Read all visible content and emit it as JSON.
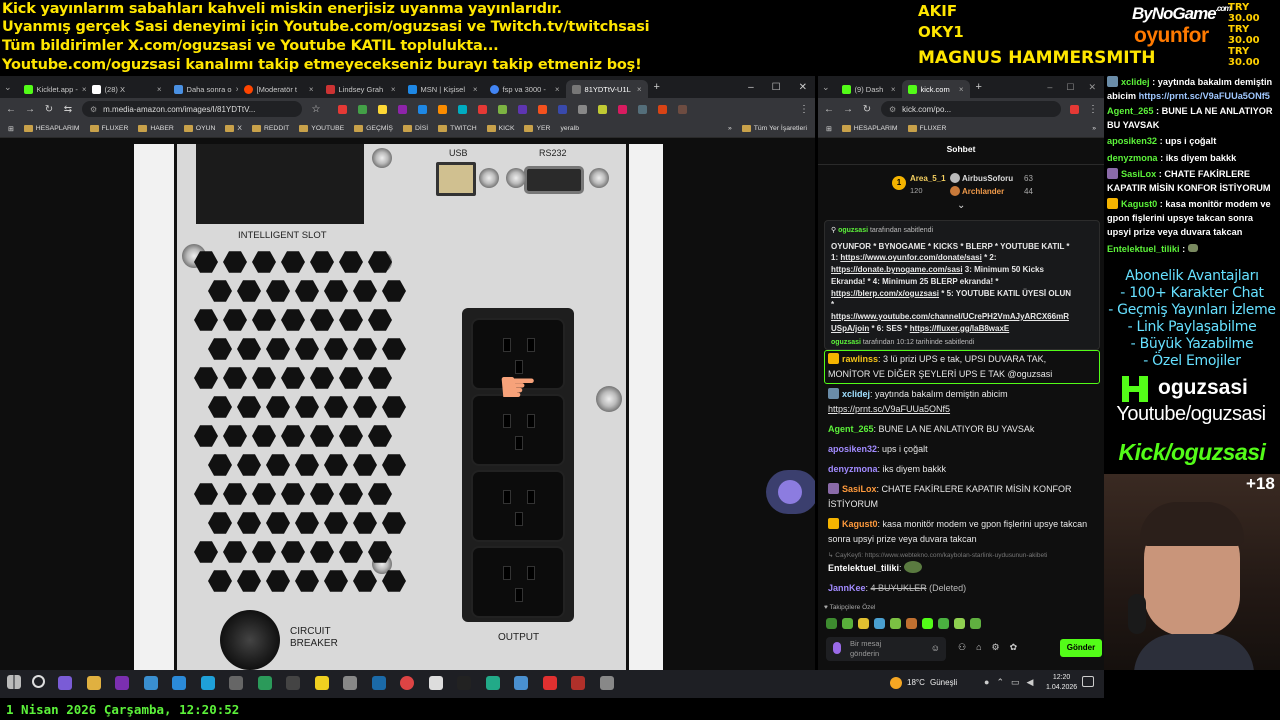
{
  "ticker": {
    "line1": "Kick yayınlarım sabahları kahveli miskin enerjisiz uyanma yayınlarıdır.",
    "line2": "Uyanmış gerçek Sasi deneyimi için Youtube.com/oguzsasi ve Twitch.tv/twitchsasi",
    "line3": "Tüm bildirimler X.com/oguzsasi ve Youtube KATIL toplulukta...",
    "line4": "Youtube.com/oguzsasi kanalımı takip etmeyecekseniz burayı takip etmeniz boş!"
  },
  "supporters": [
    "AKIF",
    "OKY1",
    "MAGNUS HAMMERSMITH"
  ],
  "brand": {
    "bynogame": "ByNoGame",
    "bynogame_sup": ".com",
    "oyunfor": "oyunfor"
  },
  "donations": [
    "TRY 30.00",
    "TRY 30.00",
    "TRY 30.00"
  ],
  "browser_left": {
    "tabs": [
      "Kicklet.app -",
      "(28) X",
      "Daha sonra o",
      "[Moderatör t",
      "Lindsey Grah",
      "MSN | Kişisel",
      "fsp va 3000 -",
      "81YDTtV-U1L"
    ],
    "url": "m.media-amazon.com/images/I/81YDTtV...",
    "bookmarks": [
      "HESAPLARIM",
      "FLUXER",
      "HABER",
      "OYUN",
      "X",
      "REDDIT",
      "YOUTUBE",
      "GEÇMİŞ",
      "DİSİ",
      "TWITCH",
      "KICK",
      "YER",
      "yeralb"
    ],
    "all_bookmarks": "Tüm Yer İşaretleri"
  },
  "ups": {
    "usb": "USB",
    "rs232": "RS232",
    "intelligent_slot": "INTELLIGENT SLOT",
    "circuit_breaker_1": "CIRCUIT",
    "circuit_breaker_2": "BREAKER",
    "output": "OUTPUT"
  },
  "browser_right": {
    "tabs": [
      "(9) Dash",
      "kick.com"
    ],
    "url": "kick.com/po...",
    "bookmarks": [
      "HESAPLARIM",
      "FLUXER"
    ],
    "chat_title": "Sohbet",
    "leaderboard": [
      {
        "rank": "1",
        "name": "Area_5_1",
        "value": "120"
      },
      {
        "name": "AirbusSoforu",
        "value": "63"
      },
      {
        "name": "Archlander",
        "value": "44"
      }
    ],
    "pinned": {
      "by": "oguzsasi",
      "by_suffix": "tarafından sabitlendi",
      "l1": "OYUNFOR * BYNOGAME * KICKS * BLERP * YOUTUBE KATIL *",
      "l2a": "1: ",
      "l2link": "https://www.oyunfor.com/donate/sasi",
      "l2b": " * 2:",
      "l3link": "https://donate.bynogame.com/sasi",
      "l3b": " 3: Minimum 50 Kicks",
      "l4": "Ekranda! * 4: Minimum 25 BLERP ekranda! *",
      "l5link": "https://blerp.com/x/oguzsasi",
      "l5b": " * 5: YOUTUBE KATIL ÜYESİ OLUN",
      "l6": "*",
      "l7link": "https://www.youtube.com/channel/UCrePH2VmAJyARCX66mR",
      "l8link": "USpA/join",
      "l8b": " * 6: SES * ",
      "l8link2": "https://fluxer.gg/laB8waxE",
      "foot_user": "oguzsasi",
      "foot": "tarafından 10:12 tarihinde sabitlendi"
    },
    "messages": [
      {
        "user": "rawlinss",
        "text": "3 lü prizi UPS e tak, UPSI DUVARA TAK, MONİTOR VE DİĞER ŞEYLERİ UPS E TAK @oguzsasi",
        "color": "#f5c518"
      },
      {
        "user": "xclidej",
        "text": "yaytında bakalım demiştin abicim",
        "link": "https://prnt.sc/V9aFUUa5ONf5",
        "color": "#a0e0ff"
      },
      {
        "user": "Agent_265",
        "text": "BUNE LA NE ANLATIYOR BU YAVSAk",
        "color": "#5cf23a"
      },
      {
        "user": "aposiken32",
        "text": "ups i çoğalt",
        "color": "#a28bff"
      },
      {
        "user": "denyzmona",
        "text": "iks diyem bakkk",
        "color": "#a28bff"
      },
      {
        "user": "SasiLox",
        "text": "CHATE FAKİRLERE KAPATIR MİSİN KONFOR İSTİYORUM",
        "color": "#ff9a3c"
      },
      {
        "user": "Kagust0",
        "text": "kasa monitör modem ve gpon fişlerini upsye takcan sonra upsyi prize veya duvara takcan",
        "color": "#ff9a3c"
      },
      {
        "user": "CayKeyfi",
        "text": "https://www.webtekno.com/kaybolan-starlink-uydusunun-akibeti",
        "color": "#888"
      },
      {
        "user": "Entelektuel_tiliki",
        "text": "",
        "color": "#ffffff"
      },
      {
        "user": "JannKee",
        "text": "4 BUYUKLER",
        "deleted": "(Deleted)",
        "color": "#a28bff"
      }
    ],
    "followers_label": "Takipçilere Özel",
    "input_placeholder_1": "Bir mesaj",
    "input_placeholder_2": "gönderin",
    "send": "Gönder"
  },
  "overlay_chat": [
    {
      "user": "xclidej",
      "text": "yaytında bakalım demiştin abicim",
      "link": "https://prnt.sc/V9aFUUa5ONf5"
    },
    {
      "user": "Agent_265",
      "text": "BUNE LA NE ANLATIYOR BU YAVSAK"
    },
    {
      "user": "aposiken32",
      "text": "ups i çoğalt"
    },
    {
      "user": "denyzmona",
      "text": "iks diyem bakkk"
    },
    {
      "user": "SasiLox",
      "text": "CHATE FAKİRLERE KAPATIR MİSİN KONFOR İSTİYORUM"
    },
    {
      "user": "Kagust0",
      "text": "kasa monitör modem ve gpon fişlerini upsye takcan sonra upsyi prize veya duvara takcan"
    },
    {
      "user": "Entelektuel_tiliki",
      "text": ""
    }
  ],
  "perks": {
    "title": "Abonelik Avantajları",
    "items": [
      "- 100+ Karakter Chat",
      "- Geçmiş Yayınları İzleme",
      "- Link Paylaşabilme",
      "- Büyük Yazabilme",
      "- Özel Emojiler"
    ]
  },
  "channel": {
    "kick_name": "oguzsasi",
    "youtube": "Youtube/oguzsasi",
    "kick_banner": "Kick/oguzsasi",
    "age": "+18"
  },
  "taskbar": {
    "weather": "18°C",
    "weather_text": "Güneşli",
    "time": "12:20",
    "date": "1.04.2026"
  },
  "clock": "1 Nisan 2026 Çarşamba, 12:20:52",
  "colors": {
    "kick_green": "#53fc18",
    "ticker_yellow": "#ffe600",
    "oyunfor_orange": "#ff7a00"
  }
}
